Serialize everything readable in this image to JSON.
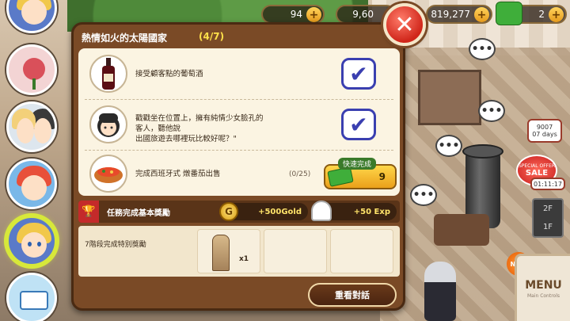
{
  "hud": {
    "gems": "94",
    "gold": "9,60",
    "cash": "819,277",
    "tickets": "2"
  },
  "right_panel": {
    "timer1_value": "9007",
    "timer1_label": "07 days",
    "sale_top": "SPECIAL OFFER",
    "sale_label": "SALE",
    "sale_timer": "01:11:17",
    "floor_up": "2F",
    "floor_current": "1F",
    "new_label": "NEW",
    "menu_label": "MENU",
    "menu_sub": "Main Controls"
  },
  "dialog": {
    "title": "熱情如火的太陽國家",
    "progress": "(4/7)",
    "close_symbol": "✕",
    "quests": [
      {
        "text": "接受顧客點的葡萄酒",
        "status": "completed"
      },
      {
        "text_lines": [
          "戳戳坐在位置上，擁有純情少女臉孔的",
          "客人，聽他說",
          "出國旅遊去哪裡玩比較好呢？\""
        ],
        "status": "completed"
      },
      {
        "text": "完成西班牙式 燉番茄出售",
        "count": "(0/25)",
        "quick_label": "快速完成",
        "quick_cost": "9"
      }
    ],
    "basic_reward_label": "任務完成基本獎勵",
    "gold_reward": "+500Gold",
    "exp_reward": "+50 Exp",
    "special_reward_label": "7階段完成特別獎勵",
    "special_item_qty": "x1",
    "replay_button": "重看對話"
  },
  "chat_bubble": "•••",
  "colors": {
    "dialog_bg": "#7a4a26",
    "panel_bg": "#fbf4e2",
    "check_color": "#3a3fb0",
    "close_red": "#d0261a",
    "quick_gold": "#eaa01a"
  }
}
